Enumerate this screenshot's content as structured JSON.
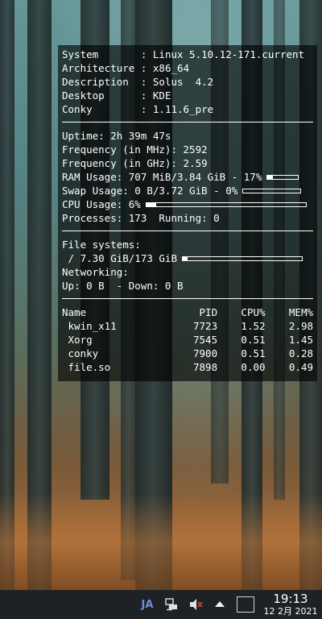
{
  "system": {
    "rows": [
      {
        "label": "System",
        "value": "Linux 5.10.12-171.current"
      },
      {
        "label": "Architecture",
        "value": "x86_64"
      },
      {
        "label": "Description",
        "value": "Solus  4.2"
      },
      {
        "label": "Desktop",
        "value": "KDE"
      },
      {
        "label": "Conky",
        "value": "1.11.6_pre"
      }
    ]
  },
  "stats": {
    "uptime": "Uptime: 2h 39m 47s",
    "freq_mhz": "Frequency (in MHz): 2592",
    "freq_ghz": "Frequency (in GHz): 2.59",
    "ram": "RAM Usage: 707 MiB/3.84 GiB - 17%",
    "ram_percent": 17,
    "swap": "Swap Usage: 0 B/3.72 GiB - 0%",
    "swap_percent": 0,
    "cpu": "CPU Usage: 6%",
    "cpu_percent": 6,
    "processes": "Processes: 173  Running: 0"
  },
  "storage": {
    "fs_title": "File systems:",
    "root": " / 7.30 GiB/173 GiB",
    "root_percent": 4,
    "net_title": "Networking:",
    "net": "Up: 0 B  - Down: 0 B"
  },
  "processes": {
    "headers": [
      "Name",
      "PID",
      "CPU%",
      "MEM%"
    ],
    "rows": [
      {
        "name": " kwin_x11",
        "pid": "7723",
        "cpu": "1.52",
        "mem": "2.98"
      },
      {
        "name": " Xorg",
        "pid": "7545",
        "cpu": "0.51",
        "mem": "1.45"
      },
      {
        "name": " conky",
        "pid": "7900",
        "cpu": "0.51",
        "mem": "0.28"
      },
      {
        "name": " file.so",
        "pid": "7898",
        "cpu": "0.00",
        "mem": "0.49"
      }
    ]
  },
  "taskbar": {
    "input_method": "JA",
    "time": "19:13",
    "date": "12 2月 2021",
    "icons": [
      "network-icon",
      "volume-muted-icon",
      "tray-expand-icon",
      "show-desktop-icon"
    ]
  }
}
